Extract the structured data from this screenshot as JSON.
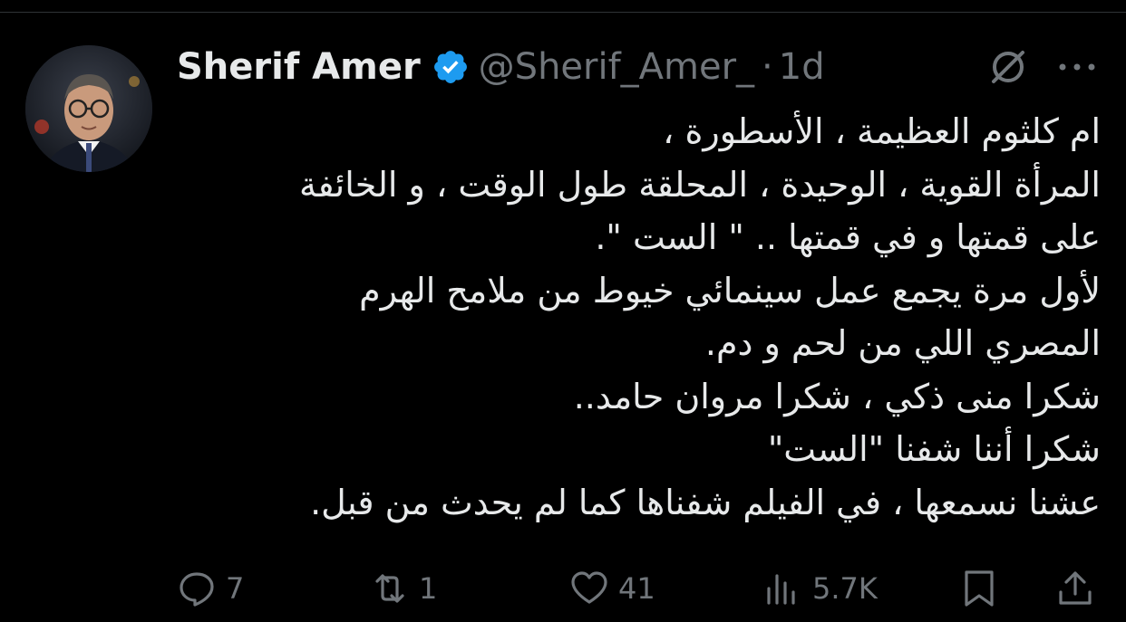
{
  "author": {
    "name": "Sherif Amer",
    "handle": "@Sherif_Amer_",
    "separator": "·",
    "time": "1d",
    "verified": true
  },
  "tweet": {
    "lines": [
      "ام كلثوم العظيمة ، الأسطورة ،",
      "المرأة القوية ، الوحيدة ، المحلقة طول الوقت ، و الخائفة",
      "على قمتها و في قمتها .. \" الست \".",
      "لأول مرة يجمع عمل سينمائي خيوط من ملامح الهرم",
      "المصري اللي من لحم و دم.",
      "شكرا منى ذكي ، شكرا مروان حامد..",
      "شكرا أننا شفنا \"الست\"",
      "عشنا نسمعها ، في الفيلم شفناها كما لم يحدث من قبل."
    ]
  },
  "actions": {
    "replies": "7",
    "reposts": "1",
    "likes": "41",
    "views": "5.7K"
  },
  "icons": {
    "verified": "verified-badge-icon",
    "grok": "grok-icon",
    "more": "more-icon",
    "reply": "reply-icon",
    "repost": "repost-icon",
    "like": "heart-icon",
    "views": "views-icon",
    "bookmark": "bookmark-icon",
    "share": "share-icon"
  },
  "colors": {
    "background": "#000000",
    "text": "#e7e9ea",
    "muted": "#71767b",
    "verified": "#1d9bf0"
  }
}
